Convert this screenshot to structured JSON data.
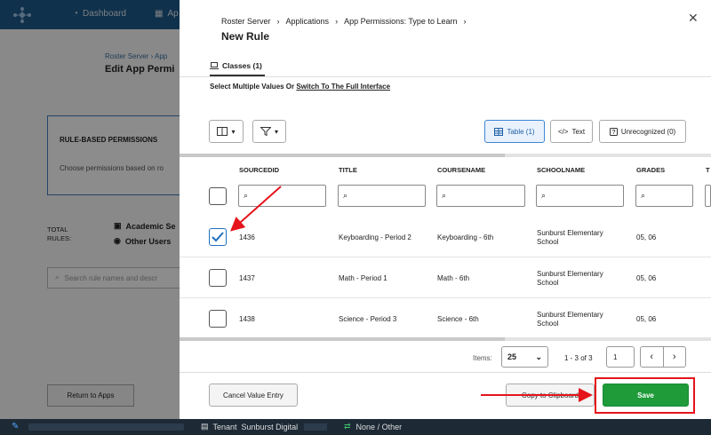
{
  "background": {
    "nav": {
      "dashboard": "Dashboard",
      "apps": "Ap"
    },
    "breadcrumb": "Roster Server  ›  App",
    "title": "Edit App Permi",
    "card_heading": "RULE-BASED PERMISSIONS",
    "card_text": "Choose permissions based on ro",
    "total_rules_label": "TOTAL RULES:",
    "rules": [
      "Academic Se",
      "Other Users"
    ],
    "search_placeholder": "Search rule names and descr",
    "return_button": "Return to Apps"
  },
  "panel": {
    "breadcrumb": [
      "Roster Server",
      "Applications",
      "App Permissions: Type to Learn"
    ],
    "title": "New Rule",
    "tab_label": "Classes (1)",
    "subline_text": "Select Multiple Values Or ",
    "subline_link": "Switch To The Full Interface",
    "view_buttons": {
      "table": "Table  (1)",
      "text": "Text",
      "unrecognized": "Unrecognized  (0)"
    },
    "columns": [
      "SOURCEDID",
      "TITLE",
      "COURSENAME",
      "SCHOOLNAME",
      "GRADES",
      "T"
    ],
    "rows": [
      {
        "checked": true,
        "sourcedid": "1436",
        "title": "Keyboarding - Period 2",
        "coursename": "Keyboarding - 6th",
        "school_line1": "Sunburst Elementary",
        "school_line2": "School",
        "grades": "05, 06"
      },
      {
        "checked": false,
        "sourcedid": "1437",
        "title": "Math - Period 1",
        "coursename": "Math - 6th",
        "school_line1": "Sunburst Elementary",
        "school_line2": "School",
        "grades": "05, 06"
      },
      {
        "checked": false,
        "sourcedid": "1438",
        "title": "Science - Period 3",
        "coursename": "Science - 6th",
        "school_line1": "Sunburst Elementary",
        "school_line2": "School",
        "grades": "05, 06"
      }
    ],
    "pager": {
      "items_label": "Items:",
      "page_size": "25",
      "range": "1 - 3 of 3",
      "page": "1"
    },
    "buttons": {
      "cancel": "Cancel Value Entry",
      "copy": "Copy to Clipboard",
      "save": "Save"
    }
  },
  "statusbar": {
    "tenant_label": "Tenant",
    "tenant_name": "Sunburst Digital",
    "context": "None / Other"
  },
  "colors": {
    "accent": "#1f70c1",
    "save": "#1f9b3a",
    "annotation": "#e5141b"
  }
}
